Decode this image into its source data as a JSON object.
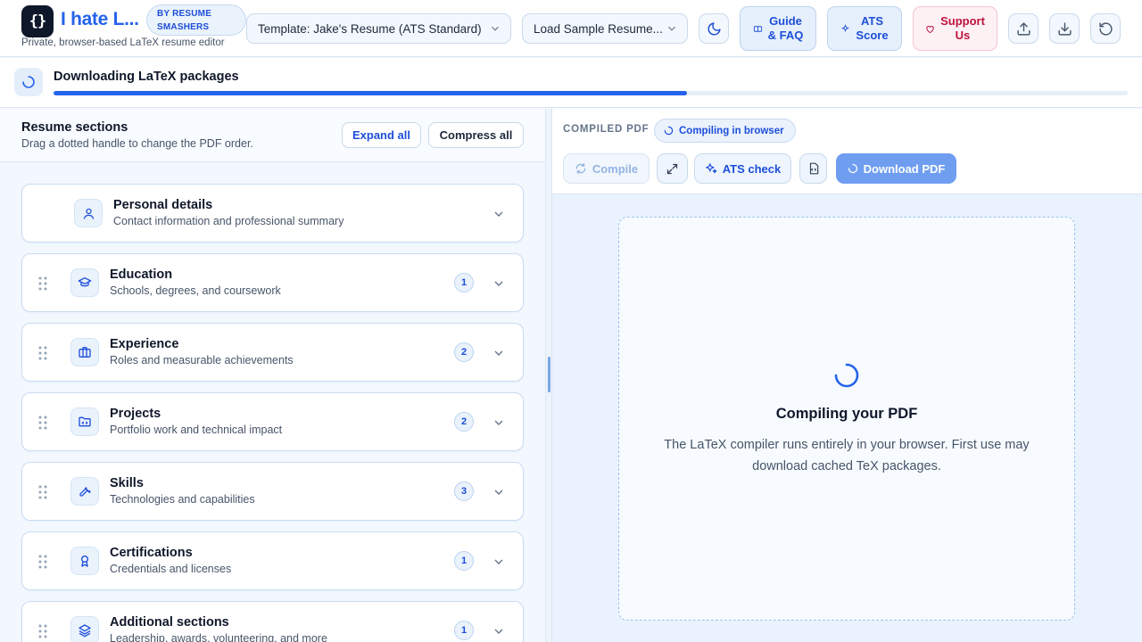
{
  "header": {
    "logo_glyph": "{}",
    "app_title": "I hate L...",
    "badge_line1": "BY RESUME",
    "badge_line2": "SMASHERS",
    "subtitle": "Private, browser-based LaTeX resume editor",
    "template_select": "Template: Jake's Resume (ATS Standard)",
    "sample_select": "Load Sample Resume...",
    "guide_line1": "Guide",
    "guide_line2": "& FAQ",
    "ats_line1": "ATS",
    "ats_line2": "Score",
    "support_line1": "Support",
    "support_line2": "Us",
    "icons": [
      "moon-icon",
      "upload-icon",
      "download-icon",
      "reset-icon"
    ]
  },
  "progress": {
    "label": "Downloading LaTeX packages",
    "percent": 59
  },
  "left": {
    "title": "Resume sections",
    "subtitle": "Drag a dotted handle to change the PDF order.",
    "expand_all": "Expand all",
    "compress_all": "Compress all",
    "sections": [
      {
        "title": "Personal details",
        "subtitle": "Contact information and professional summary",
        "count": "",
        "icon": "user-icon"
      },
      {
        "title": "Education",
        "subtitle": "Schools, degrees, and coursework",
        "count": "1",
        "icon": "graduation-cap-icon"
      },
      {
        "title": "Experience",
        "subtitle": "Roles and measurable achievements",
        "count": "2",
        "icon": "briefcase-icon"
      },
      {
        "title": "Projects",
        "subtitle": "Portfolio work and technical impact",
        "count": "2",
        "icon": "folder-code-icon"
      },
      {
        "title": "Skills",
        "subtitle": "Technologies and capabilities",
        "count": "3",
        "icon": "wrench-icon"
      },
      {
        "title": "Certifications",
        "subtitle": "Credentials and licenses",
        "count": "1",
        "icon": "award-icon"
      },
      {
        "title": "Additional sections",
        "subtitle": "Leadership, awards, volunteering, and more",
        "count": "1",
        "icon": "layers-icon"
      }
    ]
  },
  "right": {
    "label": "COMPILED PDF",
    "badge": "Compiling in browser",
    "compile": "Compile",
    "ats_check": "ATS check",
    "download_pdf": "Download PDF",
    "status_title": "Compiling your PDF",
    "status_desc": "The LaTeX compiler runs entirely in your browser. First use may download cached TeX packages."
  },
  "colors": {
    "accent": "#2563eb",
    "support": "#be123c",
    "primary_disabled": "#6f9ef0"
  }
}
